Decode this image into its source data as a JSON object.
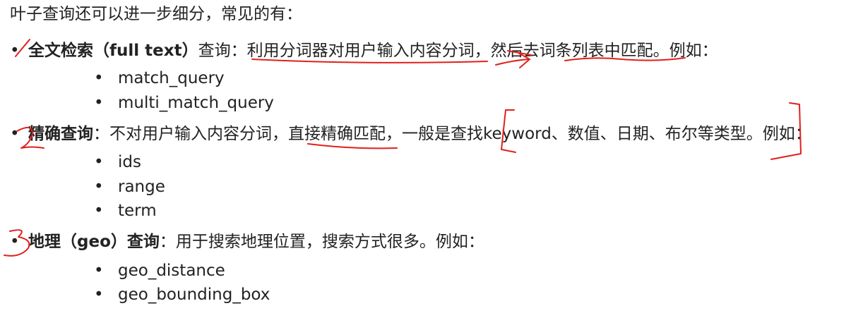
{
  "intro": "叶子查询还可以进一步细分，常见的有：",
  "bullet_glyph": "•",
  "categories": [
    {
      "title": "全文检索（full text）",
      "desc": "查询：利用分词器对用户输入内容分词，然后去词条列表中匹配。例如：",
      "examples": [
        "match_query",
        "multi_match_query"
      ]
    },
    {
      "title": "精确查询",
      "desc": "：不对用户输入内容分词，直接精确匹配，一般是查找keyword、数值、日期、布尔等类型。例如：",
      "examples": [
        "ids",
        "range",
        "term"
      ]
    },
    {
      "title": "地理（geo）查询",
      "desc": "：用于搜索地理位置，搜索方式很多。例如：",
      "examples": [
        "geo_distance",
        "geo_bounding_box"
      ]
    }
  ],
  "annotation_color": "#e0201c"
}
